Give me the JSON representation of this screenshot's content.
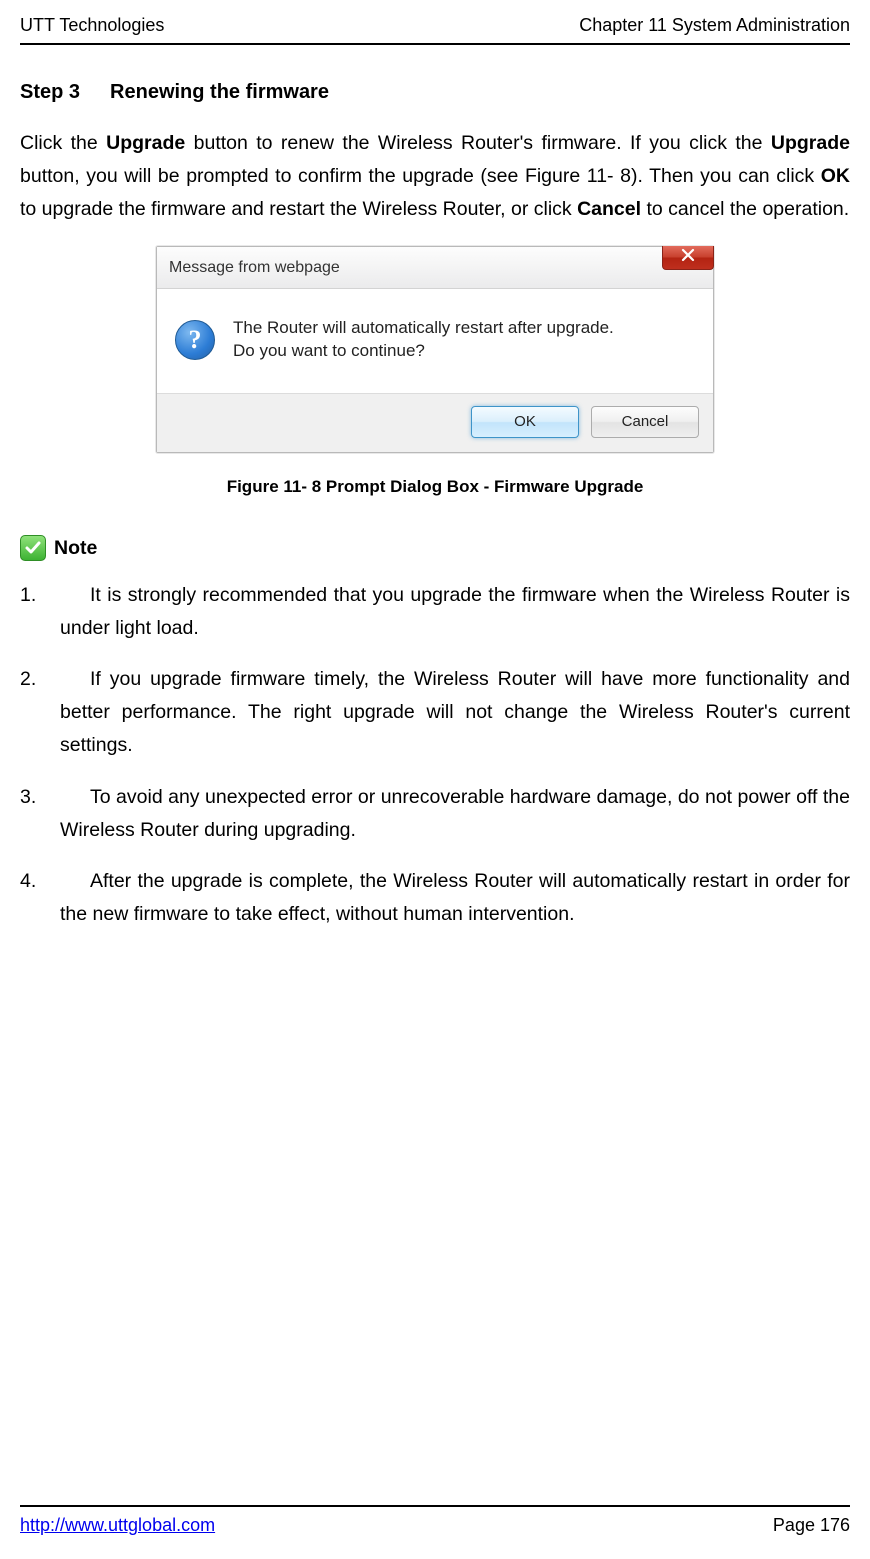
{
  "header": {
    "left": "UTT Technologies",
    "right": "Chapter 11 System Administration"
  },
  "step": {
    "label": "Step 3",
    "title": "Renewing the firmware"
  },
  "paragraph": {
    "p1a": "Click the ",
    "p1b": "Upgrade",
    "p1c": " button to renew the Wireless Router's firmware. If you click the ",
    "p1d": "Upgrade",
    "p1e": " button, you will be prompted to confirm the upgrade (see Figure 11- 8). Then you can click ",
    "p1f": "OK",
    "p1g": " to upgrade the firmware and restart the Wireless Router, or click ",
    "p1h": "Cancel",
    "p1i": " to cancel the operation."
  },
  "dialog": {
    "title": "Message from webpage",
    "line1": "The Router will automatically restart after upgrade.",
    "line2": "Do you want to continue?",
    "ok": "OK",
    "cancel": "Cancel",
    "question": "?"
  },
  "figure_caption": "Figure 11- 8 Prompt Dialog Box - Firmware Upgrade",
  "note_label": "Note",
  "notes": {
    "n1": {
      "num": "1.",
      "text": "It is strongly recommended that you upgrade the firmware when the Wireless Router is under light load."
    },
    "n2": {
      "num": "2.",
      "text": "If you upgrade firmware timely, the Wireless Router will have more functionality and better performance. The right upgrade will not change the Wireless Router's current settings."
    },
    "n3": {
      "num": "3.",
      "text": "To avoid any unexpected error or unrecoverable hardware damage, do not power off the Wireless Router during upgrading."
    },
    "n4": {
      "num": "4.",
      "text": "After the upgrade is complete, the Wireless Router will automatically restart in order for the new firmware to take effect, without human intervention."
    }
  },
  "footer": {
    "link": "http://www.uttglobal.com",
    "page": "Page 176"
  }
}
